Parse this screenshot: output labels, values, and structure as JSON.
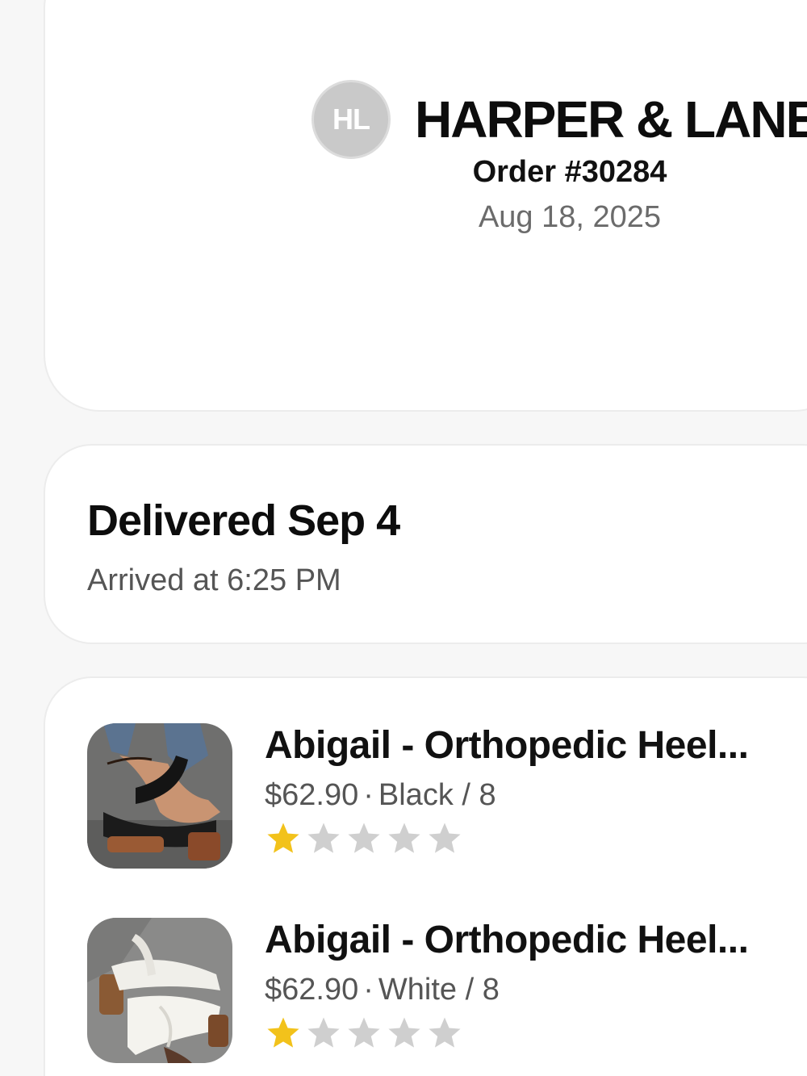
{
  "header": {
    "logo_initials": "HL",
    "brand_name": "HARPER & LANE",
    "order_number": "Order #30284",
    "order_date": "Aug 18, 2025"
  },
  "delivery": {
    "title": "Delivered Sep 4",
    "subtitle": "Arrived at 6:25 PM"
  },
  "items": [
    {
      "title": "Abigail - Orthopedic Heel...",
      "price": "$62.90",
      "separator": "·",
      "variant": "Black / 8",
      "rating": 1,
      "rating_max": 5,
      "image_icon": "black-sandal-image"
    },
    {
      "title": "Abigail - Orthopedic Heel...",
      "price": "$62.90",
      "separator": "·",
      "variant": "White / 8",
      "rating": 1,
      "rating_max": 5,
      "image_icon": "white-sandal-image"
    }
  ],
  "colors": {
    "star_filled": "#f2c21b",
    "star_empty": "#cfcfcf",
    "logo_bg": "#c9c9c9"
  }
}
